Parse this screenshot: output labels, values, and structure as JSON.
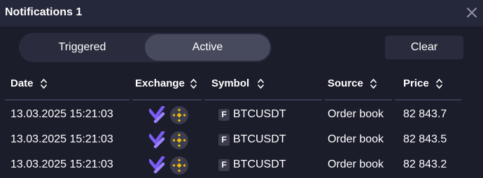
{
  "window": {
    "title": "Notifications 1",
    "close_icon": "close-icon"
  },
  "tabs": {
    "triggered": "Triggered",
    "active": "Active",
    "selected": "Active"
  },
  "toolbar": {
    "clear_label": "Clear"
  },
  "table": {
    "columns": [
      "Date",
      "Exchange",
      "Symbol",
      "Source",
      "Price"
    ],
    "rows": [
      {
        "date": "13.03.2025 15:21:03",
        "exchange_icons": [
          "v-logo-icon",
          "binance-icon"
        ],
        "symbol_badge": "F",
        "symbol": "BTCUSDT",
        "source": "Order book",
        "price": "82 843.7"
      },
      {
        "date": "13.03.2025 15:21:03",
        "exchange_icons": [
          "v-logo-icon",
          "binance-icon"
        ],
        "symbol_badge": "F",
        "symbol": "BTCUSDT",
        "source": "Order book",
        "price": "82 843.5"
      },
      {
        "date": "13.03.2025 15:21:03",
        "exchange_icons": [
          "v-logo-icon",
          "binance-icon"
        ],
        "symbol_badge": "F",
        "symbol": "BTCUSDT",
        "source": "Order book",
        "price": "82 843.2"
      }
    ]
  },
  "colors": {
    "background": "#1b1d2b",
    "titlebar": "#25273a",
    "accent_purple": "#7b5cf5",
    "binance_yellow": "#f0b90b"
  }
}
